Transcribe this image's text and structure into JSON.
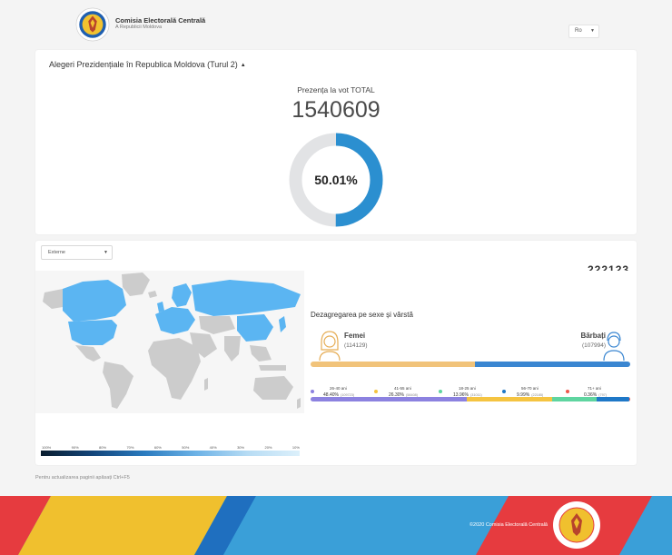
{
  "header": {
    "brand_title": "Comisia Electorală Centrală",
    "brand_subtitle": "A Republicii Moldova",
    "language": "Ro"
  },
  "turnout": {
    "title": "Alegeri Prezidențiale în Republica Moldova (Turul 2)",
    "label": "Prezența la vot TOTAL",
    "count": "1540609",
    "percent_label": "50.01%",
    "percent_value": 50.01
  },
  "region": {
    "selected": "Externe",
    "counter": "222123"
  },
  "map": {
    "legend_labels": [
      "100%",
      "90%",
      "80%",
      "70%",
      "60%",
      "50%",
      "40%",
      "30%",
      "20%",
      "10%"
    ]
  },
  "gender": {
    "title": "Dezagregarea pe sexe și vârstă",
    "women_label": "Femei",
    "women_count": "(114129)",
    "women_value": 114129,
    "men_label": "Bărbați",
    "men_count": "(107994)",
    "men_value": 107994
  },
  "age_groups": [
    {
      "range": "26-40 ani",
      "percent": "48.40%",
      "count": "(109723)",
      "value": 48.4,
      "color": "#8c82e0"
    },
    {
      "range": "41-55 ani",
      "percent": "26.30%",
      "count": "(58408)",
      "value": 26.3,
      "color": "#f5c441"
    },
    {
      "range": "18-25 ani",
      "percent": "13.96%",
      "count": "(31011)",
      "value": 13.96,
      "color": "#5fd5a0"
    },
    {
      "range": "56-70 ani",
      "percent": "9.99%",
      "count": "(22185)",
      "value": 9.99,
      "color": "#1f78c7"
    },
    {
      "range": "71+ ani",
      "percent": "0.36%",
      "count": "(797)",
      "value": 0.36,
      "color": "#f0584d"
    }
  ],
  "hint": "Pentru actualizarea paginii apăsați Ctrl+F5",
  "footer": {
    "copyright": "©2020 Comisia Electorală Centrală"
  },
  "colors": {
    "accent_blue": "#2b8fd0",
    "donut_track": "#e2e3e5",
    "map_highlight": "#5bb5f2",
    "map_base": "#cccccc",
    "women_bar": "#f1c37a",
    "men_bar": "#3a86d1"
  }
}
